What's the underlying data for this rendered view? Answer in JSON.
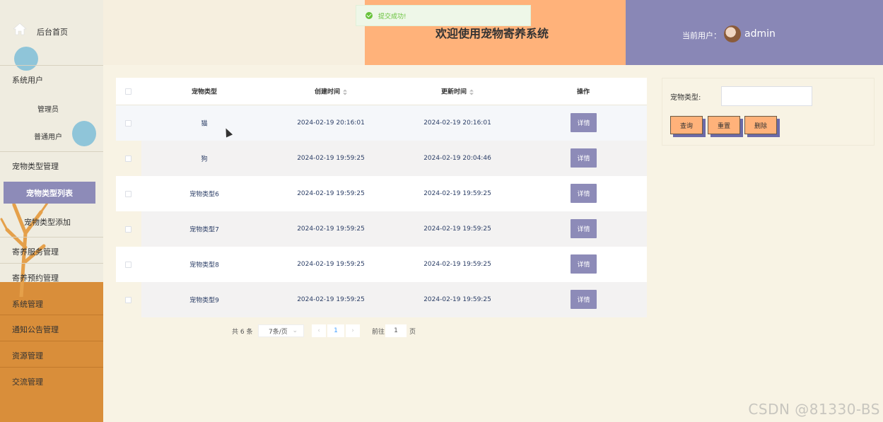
{
  "header": {
    "title": "欢迎使用宠物寄养系统",
    "user_label": "当前用户：",
    "username": "admin"
  },
  "toast": {
    "message": "提交成功!"
  },
  "sidebar": {
    "home": "后台首页",
    "sys_users": "系统用户",
    "admin": "管理员",
    "normal_user": "普通用户",
    "pet_type_mgmt": "宠物类型管理",
    "pet_type_list": "宠物类型列表",
    "pet_type_add": "宠物类型添加",
    "board_service": "寄养服务管理",
    "board_reserve": "寄养预约管理",
    "system": "系统管理",
    "notice": "通知公告管理",
    "resource": "资源管理",
    "exchange": "交流管理"
  },
  "table": {
    "headers": [
      "宠物类型",
      "创建时间",
      "更新时间",
      "操作"
    ],
    "rows": [
      {
        "type": "猫",
        "created": "2024-02-19 20:16:01",
        "updated": "2024-02-19 20:16:01",
        "action": "详情"
      },
      {
        "type": "狗",
        "created": "2024-02-19 19:59:25",
        "updated": "2024-02-19 20:04:46",
        "action": "详情"
      },
      {
        "type": "宠物类型6",
        "created": "2024-02-19 19:59:25",
        "updated": "2024-02-19 19:59:25",
        "action": "详情"
      },
      {
        "type": "宠物类型7",
        "created": "2024-02-19 19:59:25",
        "updated": "2024-02-19 19:59:25",
        "action": "详情"
      },
      {
        "type": "宠物类型8",
        "created": "2024-02-19 19:59:25",
        "updated": "2024-02-19 19:59:25",
        "action": "详情"
      },
      {
        "type": "宠物类型9",
        "created": "2024-02-19 19:59:25",
        "updated": "2024-02-19 19:59:25",
        "action": "详情"
      }
    ]
  },
  "pagination": {
    "total": "共 6 条",
    "page_size": "7条/页",
    "current_page": "1",
    "goto_label": "前往",
    "goto_value": "1",
    "page_unit": "页"
  },
  "search": {
    "label": "宠物类型:",
    "query_button": "查询",
    "reset_button": "重置",
    "delete_button": "删除"
  },
  "watermark": "CSDN @81330-BS",
  "colors": {
    "accent": "#8d8bb8",
    "orange": "#ffb27a",
    "sidebar_orange": "#d98e3a",
    "toast_green": "#67c23a"
  }
}
